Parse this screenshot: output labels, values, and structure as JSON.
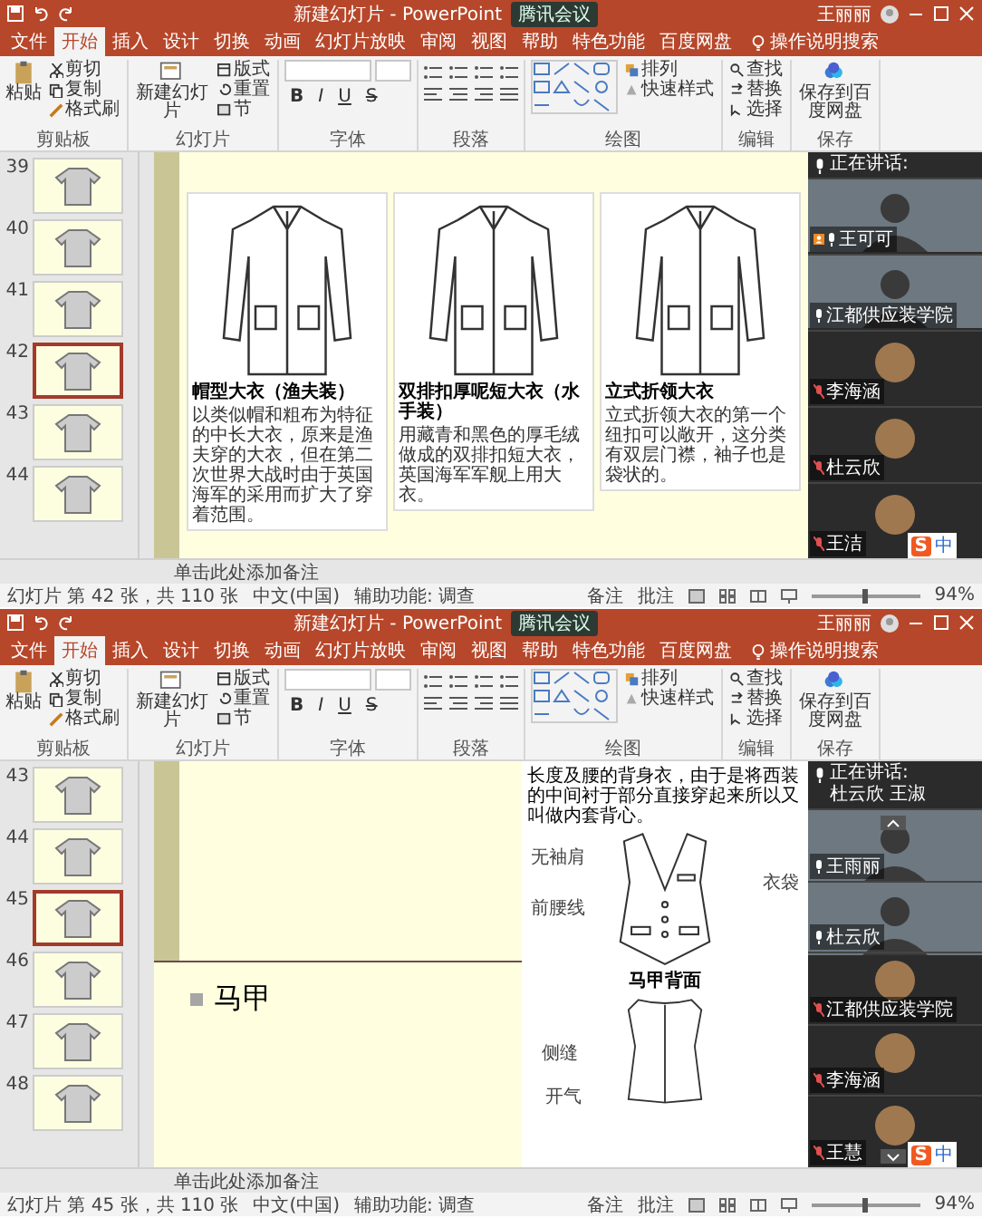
{
  "screens": [
    {
      "window": {
        "title": "新建幻灯片 - PowerPoint",
        "meeting_badge": "腾讯会议",
        "user": "王丽丽"
      },
      "tabs": [
        {
          "label": "文件",
          "selected": false
        },
        {
          "label": "开始",
          "selected": true
        },
        {
          "label": "插入",
          "selected": false
        },
        {
          "label": "设计",
          "selected": false
        },
        {
          "label": "切换",
          "selected": false
        },
        {
          "label": "动画",
          "selected": false
        },
        {
          "label": "幻灯片放映",
          "selected": false
        },
        {
          "label": "审阅",
          "selected": false
        },
        {
          "label": "视图",
          "selected": false
        },
        {
          "label": "帮助",
          "selected": false
        },
        {
          "label": "特色功能",
          "selected": false
        },
        {
          "label": "百度网盘",
          "selected": false
        }
      ],
      "search_hint": "操作说明搜索",
      "ribbon": [
        {
          "kind": "clipboard",
          "label": "剪贴板",
          "large": "粘贴",
          "small": [
            "剪切",
            "复制",
            "格式刷"
          ]
        },
        {
          "kind": "slides",
          "label": "幻灯片",
          "large": "新建幻灯片",
          "small": [
            "版式",
            "重置",
            "节"
          ]
        },
        {
          "kind": "font",
          "label": "字体",
          "small": [
            "B",
            "I",
            "U",
            "S"
          ]
        },
        {
          "kind": "paragraph",
          "label": "段落"
        },
        {
          "kind": "drawing",
          "label": "绘图",
          "small": [
            "排列",
            "快速样式"
          ]
        },
        {
          "kind": "editing",
          "label": "编辑",
          "small": [
            "查找",
            "替换",
            "选择"
          ]
        },
        {
          "kind": "save",
          "label": "保存",
          "large": "保存到百度网盘"
        }
      ],
      "thumbnails": [
        {
          "number": "39",
          "selected": false
        },
        {
          "number": "40",
          "selected": false
        },
        {
          "number": "41",
          "selected": false
        },
        {
          "number": "42",
          "selected": true
        },
        {
          "number": "43",
          "selected": false
        },
        {
          "number": "44",
          "selected": false
        }
      ],
      "slide": {
        "kind": "coats",
        "items": [
          {
            "title": "帽型大衣（渔夫装）",
            "description": "以类似帽和粗布为特征的中长大衣，原来是渔夫穿的大衣，但在第二次世界大战时由于英国海军的采用而扩大了穿着范围。"
          },
          {
            "title": "双排扣厚呢短大衣（水手装）",
            "description": "用藏青和黑色的厚毛绒做成的双排扣短大衣，英国海军军舰上用大衣。"
          },
          {
            "title": "立式折领大衣",
            "description": "立式折领大衣的第一个纽扣可以敞开，这分类有双层门襟，袖子也是袋状的。"
          }
        ]
      },
      "meeting": {
        "header": "正在讲话:",
        "scroll_arrows": false,
        "participants": [
          {
            "name": "王可可",
            "kind": "video",
            "host": true,
            "muted": false
          },
          {
            "name": "江都供应装学院",
            "kind": "video",
            "host": false,
            "muted": false
          },
          {
            "name": "李海涵",
            "kind": "avatar",
            "host": false,
            "muted": true
          },
          {
            "name": "杜云欣",
            "kind": "avatar",
            "host": false,
            "muted": true
          },
          {
            "name": "王洁",
            "kind": "avatar",
            "host": false,
            "muted": true
          }
        ]
      },
      "ime": {
        "logo": "S",
        "mode": "中"
      },
      "notes_placeholder": "单击此处添加备注",
      "status_bar": {
        "slide_info": "幻灯片 第 42 张，共 110 张",
        "language": "中文(中国)",
        "accessibility": "辅助功能: 调查",
        "notes": "备注",
        "comments": "批注",
        "zoom": "94%",
        "level": 0.5
      }
    },
    {
      "window": {
        "title": "新建幻灯片 - PowerPoint",
        "meeting_badge": "腾讯会议",
        "user": "王丽丽"
      },
      "tabs": [
        {
          "label": "文件",
          "selected": false
        },
        {
          "label": "开始",
          "selected": true
        },
        {
          "label": "插入",
          "selected": false
        },
        {
          "label": "设计",
          "selected": false
        },
        {
          "label": "切换",
          "selected": false
        },
        {
          "label": "动画",
          "selected": false
        },
        {
          "label": "幻灯片放映",
          "selected": false
        },
        {
          "label": "审阅",
          "selected": false
        },
        {
          "label": "视图",
          "selected": false
        },
        {
          "label": "帮助",
          "selected": false
        },
        {
          "label": "特色功能",
          "selected": false
        },
        {
          "label": "百度网盘",
          "selected": false
        }
      ],
      "search_hint": "操作说明搜索",
      "ribbon": [
        {
          "kind": "clipboard",
          "label": "剪贴板",
          "large": "粘贴",
          "small": [
            "剪切",
            "复制",
            "格式刷"
          ]
        },
        {
          "kind": "slides",
          "label": "幻灯片",
          "large": "新建幻灯片",
          "small": [
            "版式",
            "重置",
            "节"
          ]
        },
        {
          "kind": "font",
          "label": "字体",
          "small": [
            "B",
            "I",
            "U",
            "S"
          ]
        },
        {
          "kind": "paragraph",
          "label": "段落"
        },
        {
          "kind": "drawing",
          "label": "绘图",
          "small": [
            "排列",
            "快速样式"
          ]
        },
        {
          "kind": "editing",
          "label": "编辑",
          "small": [
            "查找",
            "替换",
            "选择"
          ]
        },
        {
          "kind": "save",
          "label": "保存",
          "large": "保存到百度网盘"
        }
      ],
      "thumbnails": [
        {
          "number": "43",
          "selected": false
        },
        {
          "number": "44",
          "selected": false
        },
        {
          "number": "45",
          "selected": true
        },
        {
          "number": "46",
          "selected": false
        },
        {
          "number": "47",
          "selected": false
        },
        {
          "number": "48",
          "selected": false
        }
      ],
      "slide": {
        "kind": "vest",
        "title": "马甲",
        "intro": "长度及腰的背身衣，由于是将西装的中间衬于部分直接穿起来所以又叫做内套背心。",
        "front_labels": [
          "无袖肩",
          "前腰线",
          "衣袋"
        ],
        "caption": "马甲背面",
        "back_labels": [
          "侧缝",
          "开气"
        ]
      },
      "meeting": {
        "header": "正在讲话:",
        "speakers": "杜云欣 王淑",
        "scroll_arrows": true,
        "participants": [
          {
            "name": "王雨丽",
            "kind": "video",
            "host": false,
            "muted": false
          },
          {
            "name": "杜云欣",
            "kind": "video",
            "host": false,
            "muted": false
          },
          {
            "name": "江都供应装学院",
            "kind": "avatar",
            "host": false,
            "muted": true
          },
          {
            "name": "李海涵",
            "kind": "avatar",
            "host": false,
            "muted": true
          },
          {
            "name": "王慧",
            "kind": "avatar",
            "host": false,
            "muted": true
          }
        ]
      },
      "ime": {
        "logo": "S",
        "mode": "中"
      },
      "notes_placeholder": "单击此处添加备注",
      "status_bar": {
        "slide_info": "幻灯片 第 45 张，共 110 张",
        "language": "中文(中国)",
        "accessibility": "辅助功能: 调查",
        "notes": "备注",
        "comments": "批注",
        "zoom": "94%",
        "level": 0.5
      }
    }
  ]
}
